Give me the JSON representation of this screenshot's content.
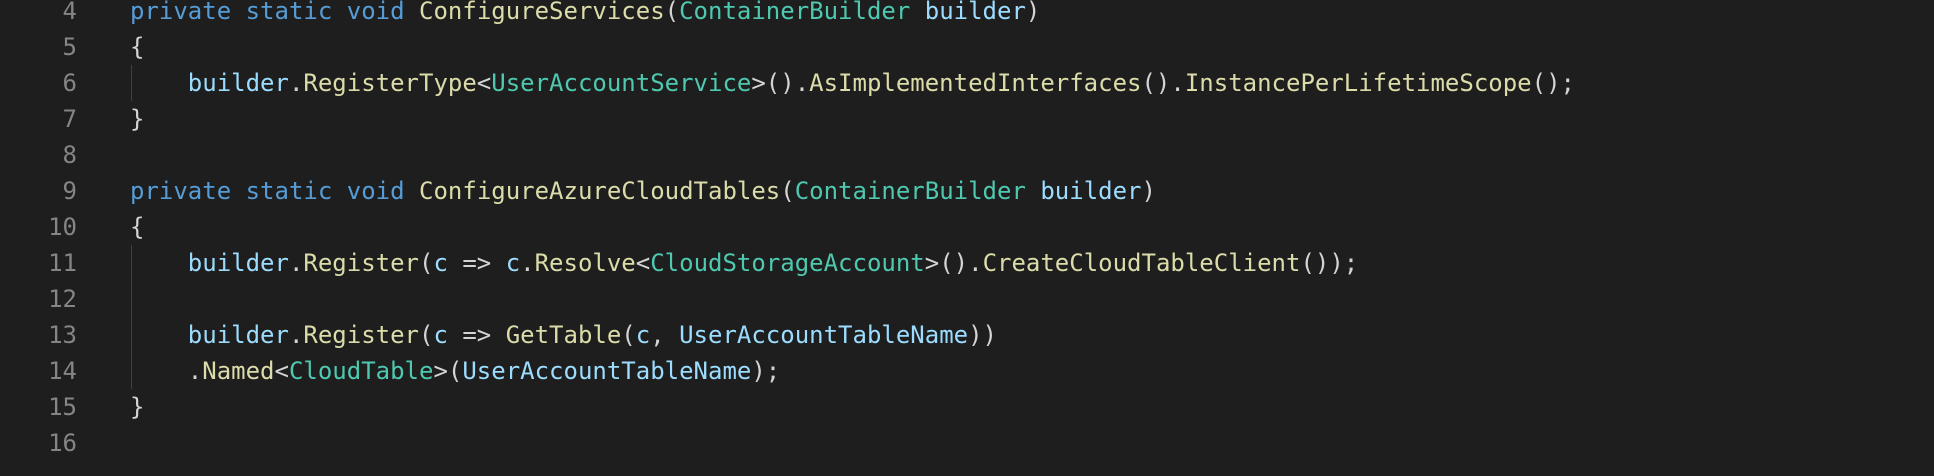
{
  "colors": {
    "background": "#1e1e1e",
    "line_number": "#858585",
    "keyword": "#569cd6",
    "method": "#dcdcaa",
    "type": "#4ec9b0",
    "parameter": "#9cdcfe",
    "punctuation": "#d4d4d4"
  },
  "lines": [
    {
      "number": "4",
      "indent_guide": false,
      "tokens": [
        {
          "text": "private",
          "kind": "keyword"
        },
        {
          "text": " ",
          "kind": "punct"
        },
        {
          "text": "static",
          "kind": "keyword"
        },
        {
          "text": " ",
          "kind": "punct"
        },
        {
          "text": "void",
          "kind": "keyword"
        },
        {
          "text": " ",
          "kind": "punct"
        },
        {
          "text": "ConfigureServices",
          "kind": "method"
        },
        {
          "text": "(",
          "kind": "punct"
        },
        {
          "text": "ContainerBuilder",
          "kind": "type"
        },
        {
          "text": " ",
          "kind": "punct"
        },
        {
          "text": "builder",
          "kind": "param"
        },
        {
          "text": ")",
          "kind": "punct"
        }
      ]
    },
    {
      "number": "5",
      "indent_guide": false,
      "tokens": [
        {
          "text": "{",
          "kind": "punct"
        }
      ]
    },
    {
      "number": "6",
      "indent_guide": true,
      "tokens": [
        {
          "text": "    ",
          "kind": "punct"
        },
        {
          "text": "builder",
          "kind": "param"
        },
        {
          "text": ".",
          "kind": "punct"
        },
        {
          "text": "RegisterType",
          "kind": "method"
        },
        {
          "text": "<",
          "kind": "punct"
        },
        {
          "text": "UserAccountService",
          "kind": "type"
        },
        {
          "text": ">().",
          "kind": "punct"
        },
        {
          "text": "AsImplementedInterfaces",
          "kind": "method"
        },
        {
          "text": "().",
          "kind": "punct"
        },
        {
          "text": "InstancePerLifetimeScope",
          "kind": "method"
        },
        {
          "text": "();",
          "kind": "punct"
        }
      ]
    },
    {
      "number": "7",
      "indent_guide": false,
      "tokens": [
        {
          "text": "}",
          "kind": "punct"
        }
      ]
    },
    {
      "number": "8",
      "indent_guide": false,
      "tokens": []
    },
    {
      "number": "9",
      "indent_guide": false,
      "tokens": [
        {
          "text": "private",
          "kind": "keyword"
        },
        {
          "text": " ",
          "kind": "punct"
        },
        {
          "text": "static",
          "kind": "keyword"
        },
        {
          "text": " ",
          "kind": "punct"
        },
        {
          "text": "void",
          "kind": "keyword"
        },
        {
          "text": " ",
          "kind": "punct"
        },
        {
          "text": "ConfigureAzureCloudTables",
          "kind": "method"
        },
        {
          "text": "(",
          "kind": "punct"
        },
        {
          "text": "ContainerBuilder",
          "kind": "type"
        },
        {
          "text": " ",
          "kind": "punct"
        },
        {
          "text": "builder",
          "kind": "param"
        },
        {
          "text": ")",
          "kind": "punct"
        }
      ]
    },
    {
      "number": "10",
      "indent_guide": false,
      "tokens": [
        {
          "text": "{",
          "kind": "punct"
        }
      ]
    },
    {
      "number": "11",
      "indent_guide": true,
      "tokens": [
        {
          "text": "    ",
          "kind": "punct"
        },
        {
          "text": "builder",
          "kind": "param"
        },
        {
          "text": ".",
          "kind": "punct"
        },
        {
          "text": "Register",
          "kind": "method"
        },
        {
          "text": "(",
          "kind": "punct"
        },
        {
          "text": "c",
          "kind": "param"
        },
        {
          "text": " => ",
          "kind": "operator"
        },
        {
          "text": "c",
          "kind": "param"
        },
        {
          "text": ".",
          "kind": "punct"
        },
        {
          "text": "Resolve",
          "kind": "method"
        },
        {
          "text": "<",
          "kind": "punct"
        },
        {
          "text": "CloudStorageAccount",
          "kind": "type"
        },
        {
          "text": ">().",
          "kind": "punct"
        },
        {
          "text": "CreateCloudTableClient",
          "kind": "method"
        },
        {
          "text": "());",
          "kind": "punct"
        }
      ]
    },
    {
      "number": "12",
      "indent_guide": true,
      "tokens": []
    },
    {
      "number": "13",
      "indent_guide": true,
      "tokens": [
        {
          "text": "    ",
          "kind": "punct"
        },
        {
          "text": "builder",
          "kind": "param"
        },
        {
          "text": ".",
          "kind": "punct"
        },
        {
          "text": "Register",
          "kind": "method"
        },
        {
          "text": "(",
          "kind": "punct"
        },
        {
          "text": "c",
          "kind": "param"
        },
        {
          "text": " => ",
          "kind": "operator"
        },
        {
          "text": "GetTable",
          "kind": "method"
        },
        {
          "text": "(",
          "kind": "punct"
        },
        {
          "text": "c",
          "kind": "param"
        },
        {
          "text": ", ",
          "kind": "punct"
        },
        {
          "text": "UserAccountTableName",
          "kind": "param"
        },
        {
          "text": "))",
          "kind": "punct"
        }
      ]
    },
    {
      "number": "14",
      "indent_guide": true,
      "tokens": [
        {
          "text": "    ",
          "kind": "punct"
        },
        {
          "text": ".",
          "kind": "punct"
        },
        {
          "text": "Named",
          "kind": "method"
        },
        {
          "text": "<",
          "kind": "punct"
        },
        {
          "text": "CloudTable",
          "kind": "type"
        },
        {
          "text": ">(",
          "kind": "punct"
        },
        {
          "text": "UserAccountTableName",
          "kind": "param"
        },
        {
          "text": ");",
          "kind": "punct"
        }
      ]
    },
    {
      "number": "15",
      "indent_guide": false,
      "tokens": [
        {
          "text": "}",
          "kind": "punct"
        }
      ]
    },
    {
      "number": "16",
      "indent_guide": false,
      "tokens": []
    }
  ]
}
